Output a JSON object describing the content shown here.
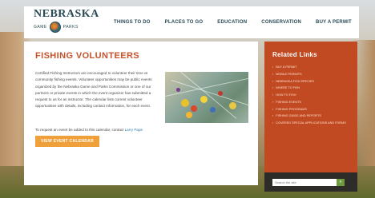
{
  "header": {
    "logo_name": "NEBRASKA",
    "logo_left": "GAME",
    "logo_right": "PARKS",
    "nav": [
      {
        "label": "THINGS TO DO"
      },
      {
        "label": "PLACES TO GO"
      },
      {
        "label": "EDUCATION"
      },
      {
        "label": "CONSERVATION"
      },
      {
        "label": "BUY A PERMIT"
      }
    ]
  },
  "main": {
    "title": "FISHING VOLUNTEERS",
    "body": "Certified Fishing Instructors are encouraged to volunteer their time at community fishing events. Volunteer opportunities may be public events organized by the Nebraska Game and Parks Commission or one of our partners or private events in which the event organizer has submitted a request to us for an instructor. The calendar lists current volunteer opportunities with details, including contact information, for each event.",
    "request_text": "To request an event be added to this calendar, contact",
    "request_link": "Larry Pape",
    "cta_label": "VIEW EVENT CALENDAR"
  },
  "sidebar": {
    "title": "Related Links",
    "items": [
      {
        "label": "BUY A PERMIT"
      },
      {
        "label": "MOBILE PERMITS"
      },
      {
        "label": "NEBRASKA FISH SPECIES"
      },
      {
        "label": "WHERE TO FISH"
      },
      {
        "label": "HOW TO FISH"
      },
      {
        "label": "FISHING EVENTS"
      },
      {
        "label": "FISHING PROGRAMS"
      },
      {
        "label": "FISHING GUIDE AND REPORTS"
      },
      {
        "label": "COVERED SPECIAL APPLICATIONS AND FORMS"
      }
    ],
    "search_placeholder": "Search the site"
  },
  "colors": {
    "accent_orange": "#c24a22",
    "title_orange": "#c8522a",
    "button_orange": "#f0a03a",
    "link_blue": "#2f7fb0"
  }
}
